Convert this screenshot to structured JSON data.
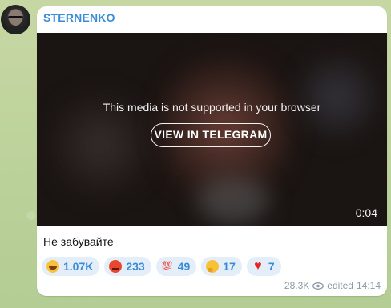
{
  "channel": {
    "name": "STERNENKO"
  },
  "media": {
    "notice": "This media is not supported in your browser",
    "button_label": "VIEW IN TELEGRAM",
    "duration": "0:04"
  },
  "message": {
    "caption": "Не забувайте"
  },
  "reactions": [
    {
      "icon": "grinning-face-icon",
      "count": "1.07K"
    },
    {
      "icon": "angry-face-icon",
      "count": "233"
    },
    {
      "icon": "hundred-points-icon",
      "count": "49"
    },
    {
      "icon": "thinking-face-icon",
      "count": "17"
    },
    {
      "icon": "red-heart-icon",
      "count": "7"
    }
  ],
  "footer": {
    "views": "28.3K",
    "edited_label": "edited",
    "time": "14:14"
  },
  "colors": {
    "accent": "#3a8bd8",
    "reaction_bg": "#e4eef8",
    "wallpaper": "#bfd3a0"
  }
}
